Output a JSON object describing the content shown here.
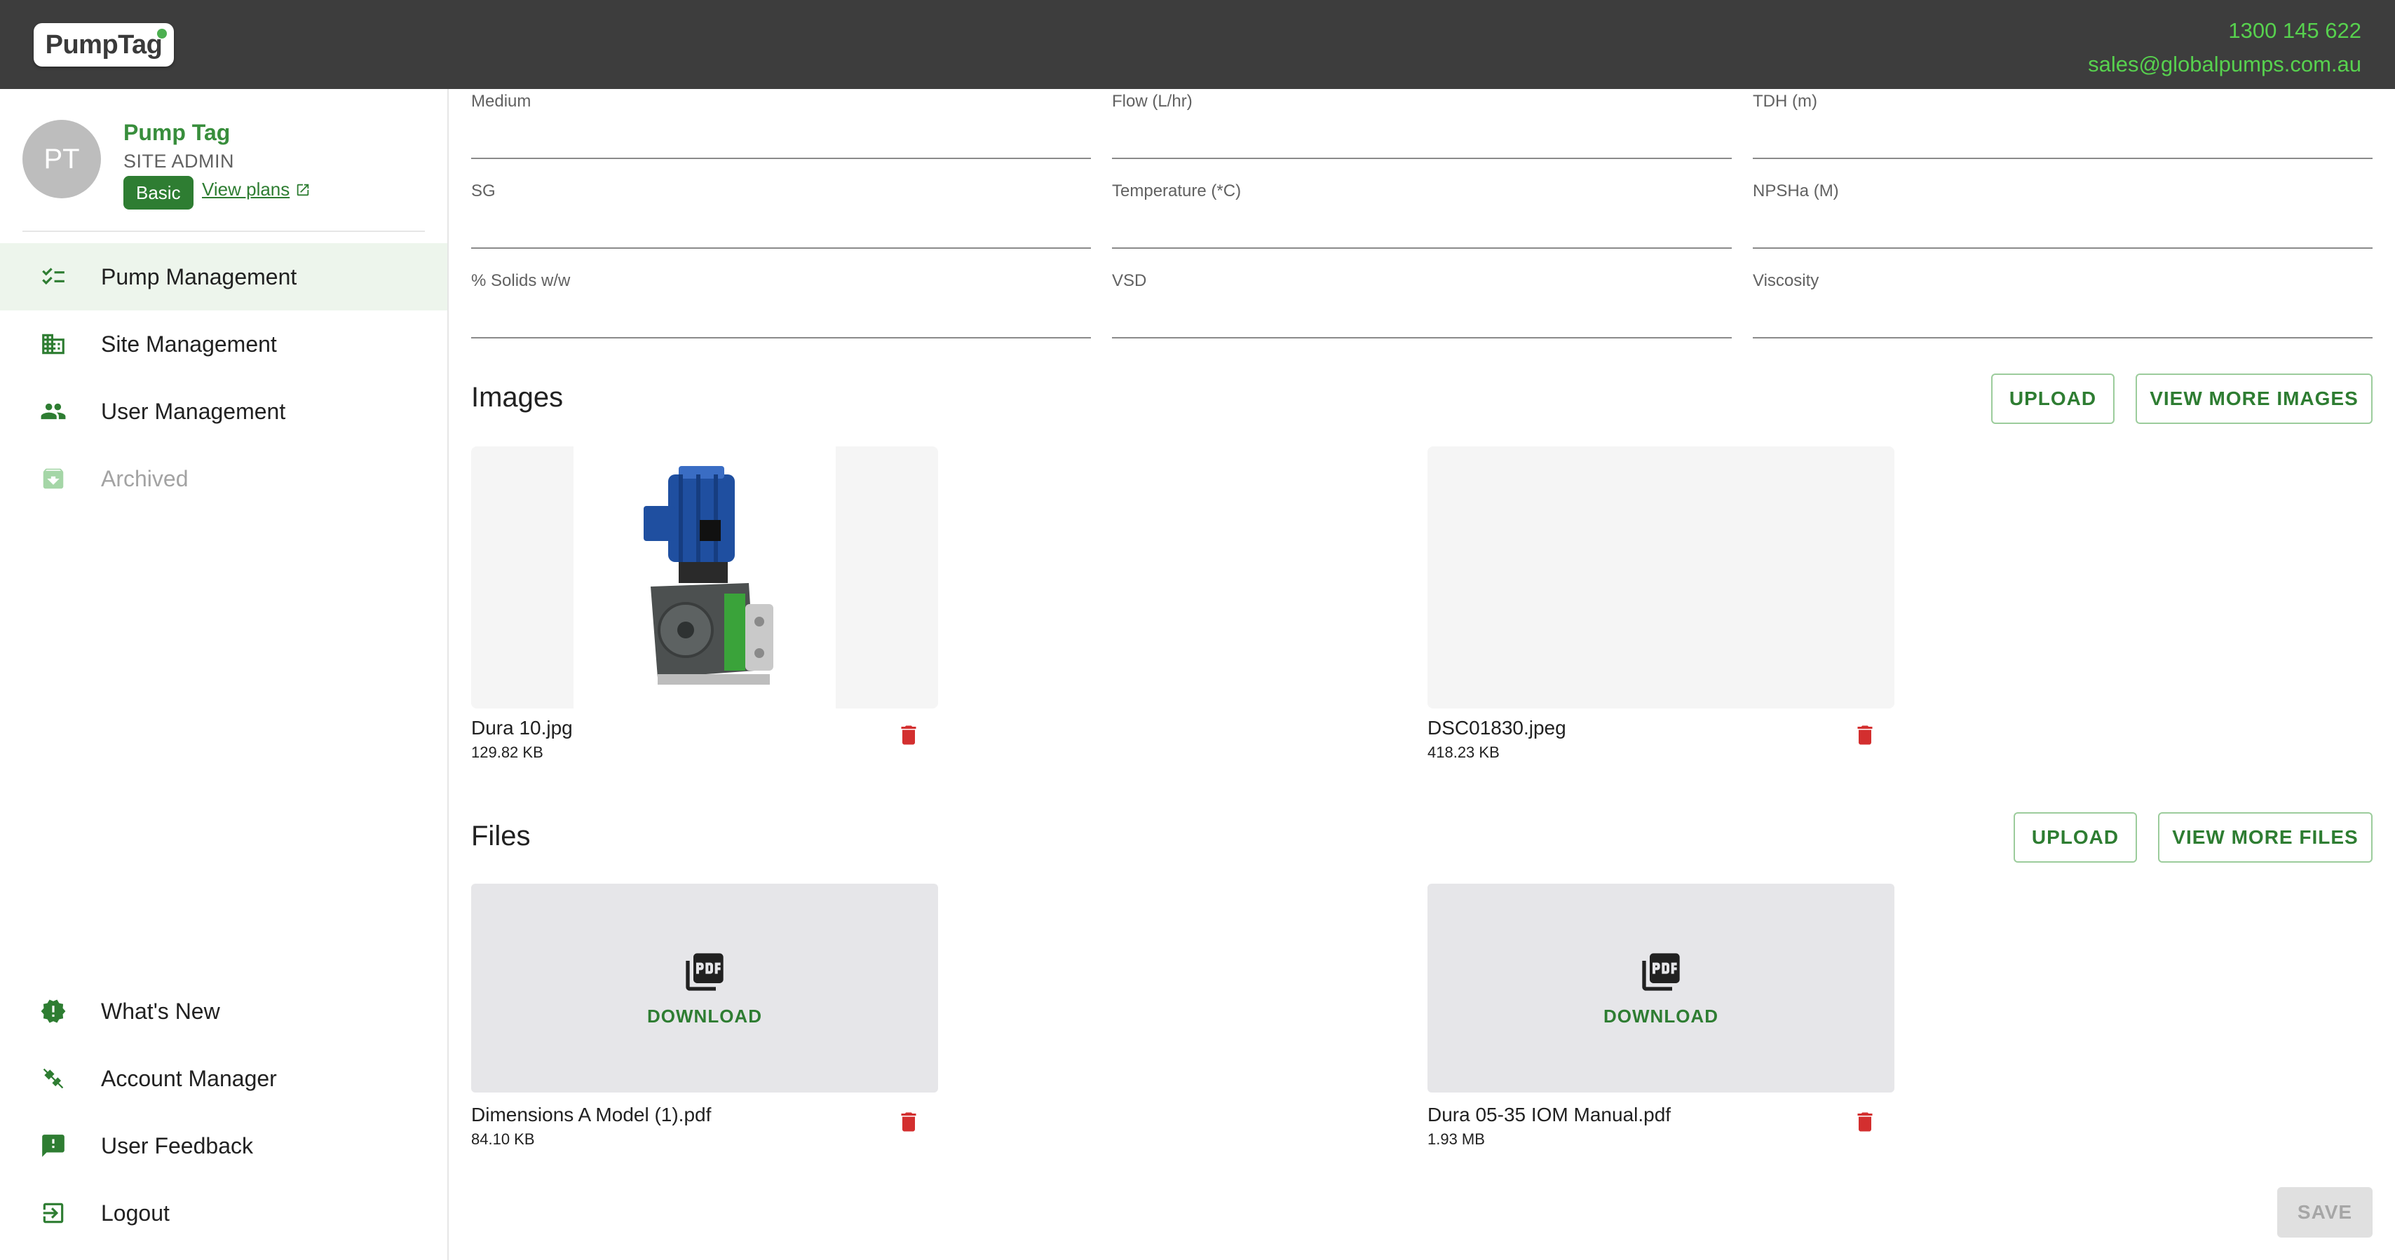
{
  "header": {
    "logo_text": "PumpTag",
    "phone": "1300 145 622",
    "email": "sales@globalpumps.com.au",
    "contact_color": "#57d14e"
  },
  "profile": {
    "initials": "PT",
    "name": "Pump Tag",
    "role": "SITE ADMIN",
    "plan": "Basic",
    "view_plans": "View plans"
  },
  "nav": {
    "pump_management": "Pump Management",
    "site_management": "Site Management",
    "user_management": "User Management",
    "archived": "Archived",
    "whats_new": "What's New",
    "account_manager": "Account Manager",
    "user_feedback": "User Feedback",
    "logout": "Logout"
  },
  "fields": {
    "medium": "Medium",
    "flow": "Flow (L/hr)",
    "tdh": "TDH (m)",
    "sg": "SG",
    "temperature": "Temperature (*C)",
    "npsha": "NPSHa (M)",
    "solids": "% Solids w/w",
    "vsd": "VSD",
    "viscosity": "Viscosity"
  },
  "images": {
    "title": "Images",
    "upload": "UPLOAD",
    "view_more": "VIEW MORE IMAGES",
    "items": [
      {
        "name": "Dura 10.jpg",
        "size": "129.82 KB"
      },
      {
        "name": "DSC01830.jpeg",
        "size": "418.23 KB"
      }
    ]
  },
  "files": {
    "title": "Files",
    "upload": "UPLOAD",
    "view_more": "VIEW MORE FILES",
    "download": "DOWNLOAD",
    "items": [
      {
        "name": "Dimensions A Model (1).pdf",
        "size": "84.10 KB"
      },
      {
        "name": "Dura 05-35 IOM Manual.pdf",
        "size": "1.93 MB"
      }
    ]
  },
  "actions": {
    "save": "SAVE"
  },
  "colors": {
    "accent": "#2e7d32",
    "delete": "#d32f2f",
    "topbar": "#3d3d3d"
  }
}
